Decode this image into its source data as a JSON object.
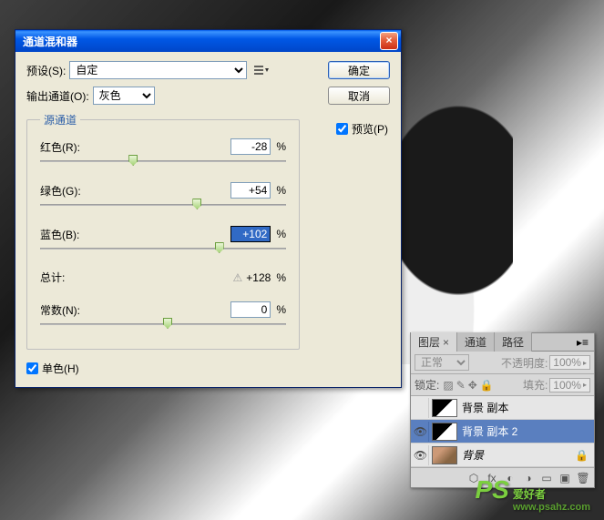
{
  "dialog": {
    "title": "通道混和器",
    "close_x": "×",
    "preset_label": "预设(S):",
    "preset_value": "自定",
    "output_label": "输出通道(O):",
    "output_value": "灰色",
    "ok": "确定",
    "cancel": "取消",
    "preview": "预览(P)",
    "fieldset": "源通道",
    "red": {
      "label": "红色(R):",
      "value": "-28",
      "pos": 36
    },
    "green": {
      "label": "绿色(G):",
      "value": "+54",
      "pos": 62
    },
    "blue": {
      "label": "蓝色(B):",
      "value": "+102",
      "pos": 71
    },
    "total_label": "总计:",
    "total_value": "+128",
    "percent": "%",
    "constant": {
      "label": "常数(N):",
      "value": "0",
      "pos": 50
    },
    "monochrome": "单色(H)"
  },
  "layers": {
    "tab_layers": "图层",
    "tab_channels": "通道",
    "tab_paths": "路径",
    "blend_mode": "正常",
    "opacity_label": "不透明度:",
    "opacity_value": "100%",
    "lock_label": "锁定:",
    "fill_label": "填充:",
    "fill_value": "100%",
    "items": [
      {
        "name": "背景 副本",
        "eye": "",
        "locked": false,
        "italic": false,
        "thumb": "bw"
      },
      {
        "name": "背景 副本 2",
        "eye": "👁",
        "locked": false,
        "italic": false,
        "thumb": "bw",
        "selected": true
      },
      {
        "name": "背景",
        "eye": "👁",
        "locked": true,
        "italic": true,
        "thumb": "color"
      }
    ]
  },
  "watermark": {
    "ps": "PS",
    "text": "爱好者",
    "url": "www.psahz.com"
  }
}
